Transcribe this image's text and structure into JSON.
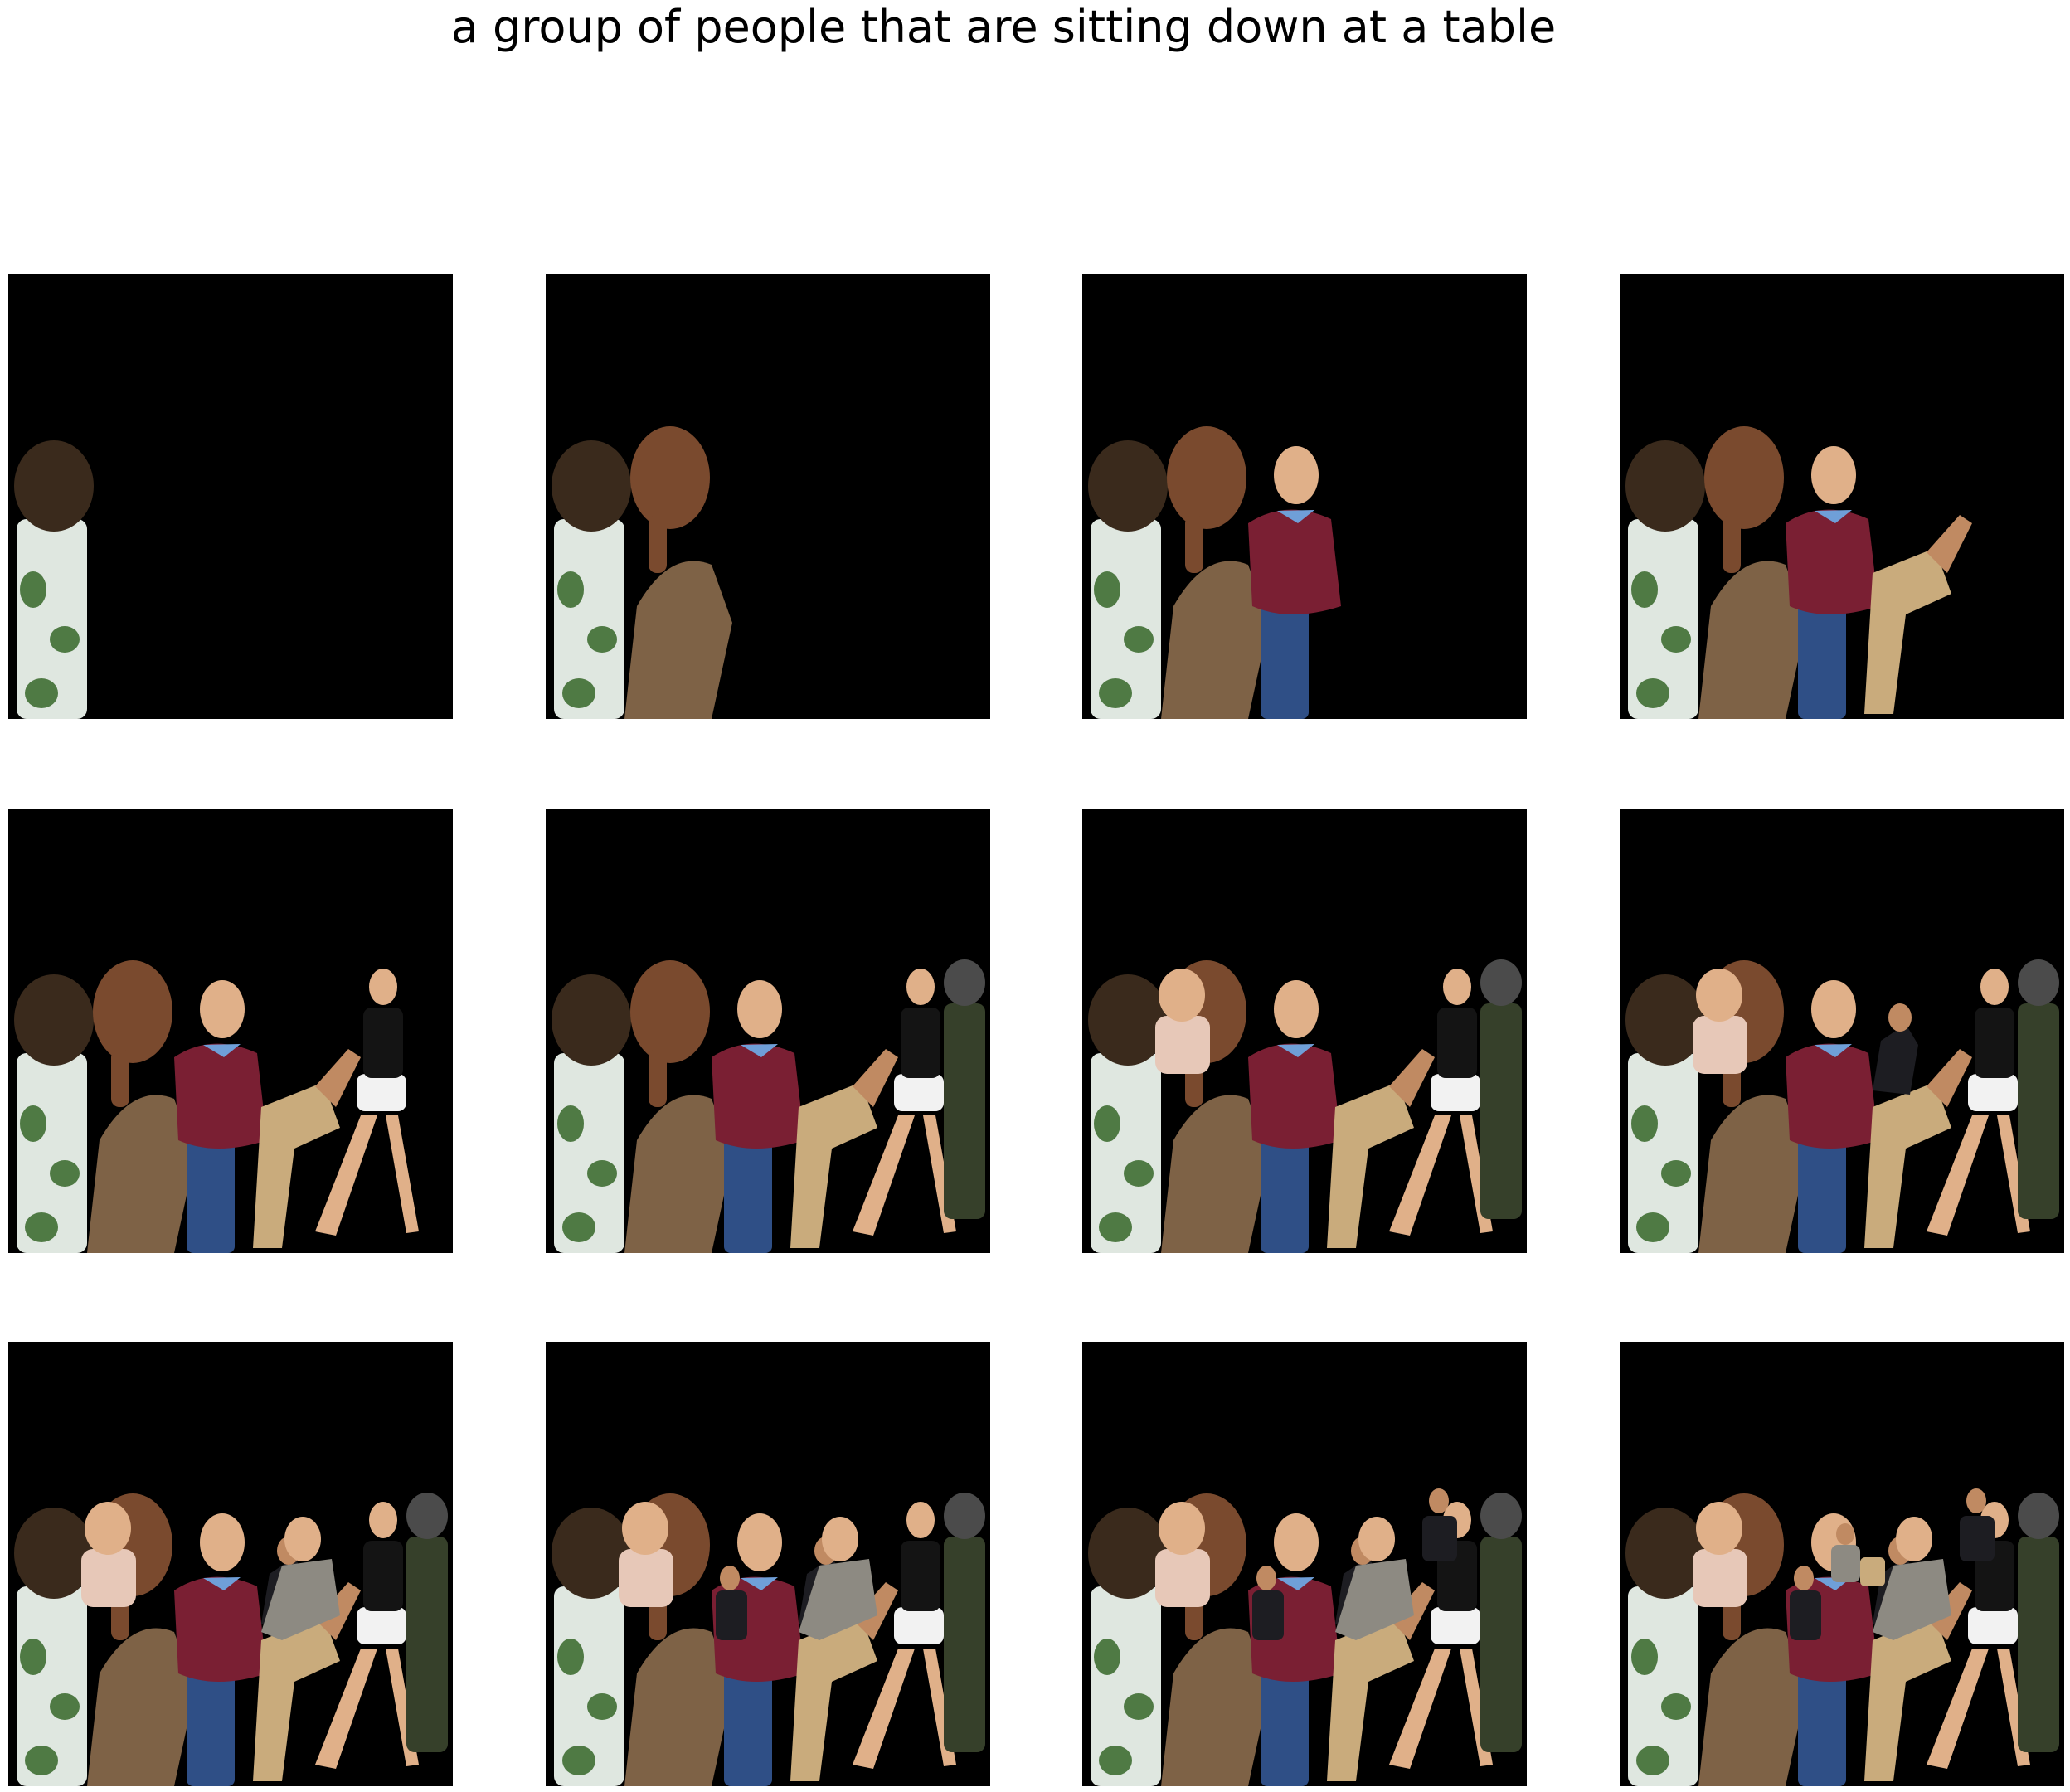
{
  "figure": {
    "title": "a group of people that are sitting down at a table"
  },
  "colors": {
    "page_background": "#ffffff",
    "panel_background": "#000000",
    "hair_dark": "#3a2a1c",
    "skin_tan": "#c08a62",
    "skin_dark": "#7a4a2e",
    "skin_light": "#e0b089",
    "shirt_floral": "#dfe7e0",
    "floral_green": "#4f7a44",
    "blouse_brown": "#7e6246",
    "sweater_maroon": "#7a1f33",
    "collar_blue": "#6f9fd8",
    "jeans_blue": "#2f4f86",
    "pants_khaki": "#c9ab7c",
    "top_black": "#141414",
    "shorts_white": "#f2f2f2",
    "suit_dark": "#1d1d22",
    "shirt_grey": "#8d8a82",
    "helmet_grey": "#4b4b4b",
    "toddler_pink": "#e7c8b8",
    "vest_olive": "#36402a"
  },
  "panels": [
    {
      "step": 1,
      "figures": [
        "curly-hair-person"
      ]
    },
    {
      "step": 2,
      "figures": [
        "curly-hair-person",
        "woman-brown-blouse"
      ]
    },
    {
      "step": 3,
      "figures": [
        "curly-hair-person",
        "woman-brown-blouse",
        "man-maroon-sweater"
      ]
    },
    {
      "step": 4,
      "figures": [
        "curly-hair-person",
        "woman-brown-blouse",
        "man-maroon-sweater",
        "seated-khaki-legs"
      ]
    },
    {
      "step": 5,
      "figures": [
        "curly-hair-person",
        "woman-brown-blouse",
        "man-maroon-sweater",
        "seated-khaki-legs",
        "woman-white-shorts"
      ]
    },
    {
      "step": 6,
      "figures": [
        "curly-hair-person",
        "woman-brown-blouse",
        "man-maroon-sweater",
        "seated-khaki-legs",
        "woman-white-shorts",
        "helmeted-person"
      ]
    },
    {
      "step": 7,
      "figures": [
        "curly-hair-person",
        "woman-brown-blouse",
        "man-maroon-sweater",
        "seated-khaki-legs",
        "woman-white-shorts",
        "helmeted-person",
        "toddler"
      ]
    },
    {
      "step": 8,
      "figures": [
        "curly-hair-person",
        "woman-brown-blouse",
        "man-maroon-sweater",
        "seated-khaki-legs",
        "woman-white-shorts",
        "helmeted-person",
        "toddler",
        "man-dark-suit"
      ]
    },
    {
      "step": 9,
      "figures": [
        "curly-hair-person",
        "woman-brown-blouse",
        "man-maroon-sweater",
        "seated-khaki-legs",
        "woman-white-shorts",
        "helmeted-person",
        "toddler",
        "man-dark-suit",
        "bald-man-grey-shirt"
      ]
    },
    {
      "step": 10,
      "figures": [
        "curly-hair-person",
        "woman-brown-blouse",
        "man-maroon-sweater",
        "seated-khaki-legs",
        "woman-white-shorts",
        "helmeted-person",
        "toddler",
        "man-dark-suit",
        "bald-man-grey-shirt",
        "small-suited-man"
      ]
    },
    {
      "step": 11,
      "figures": [
        "curly-hair-person",
        "woman-brown-blouse",
        "man-maroon-sweater",
        "seated-khaki-legs",
        "woman-white-shorts",
        "helmeted-person",
        "toddler",
        "man-dark-suit",
        "bald-man-grey-shirt",
        "small-suited-man",
        "man-upper-right"
      ]
    },
    {
      "step": 12,
      "figures": [
        "curly-hair-person",
        "woman-brown-blouse",
        "man-maroon-sweater",
        "seated-khaki-legs",
        "woman-white-shorts",
        "helmeted-person",
        "toddler",
        "man-dark-suit",
        "bald-man-grey-shirt",
        "small-suited-man",
        "man-upper-right",
        "distant-people"
      ]
    }
  ]
}
